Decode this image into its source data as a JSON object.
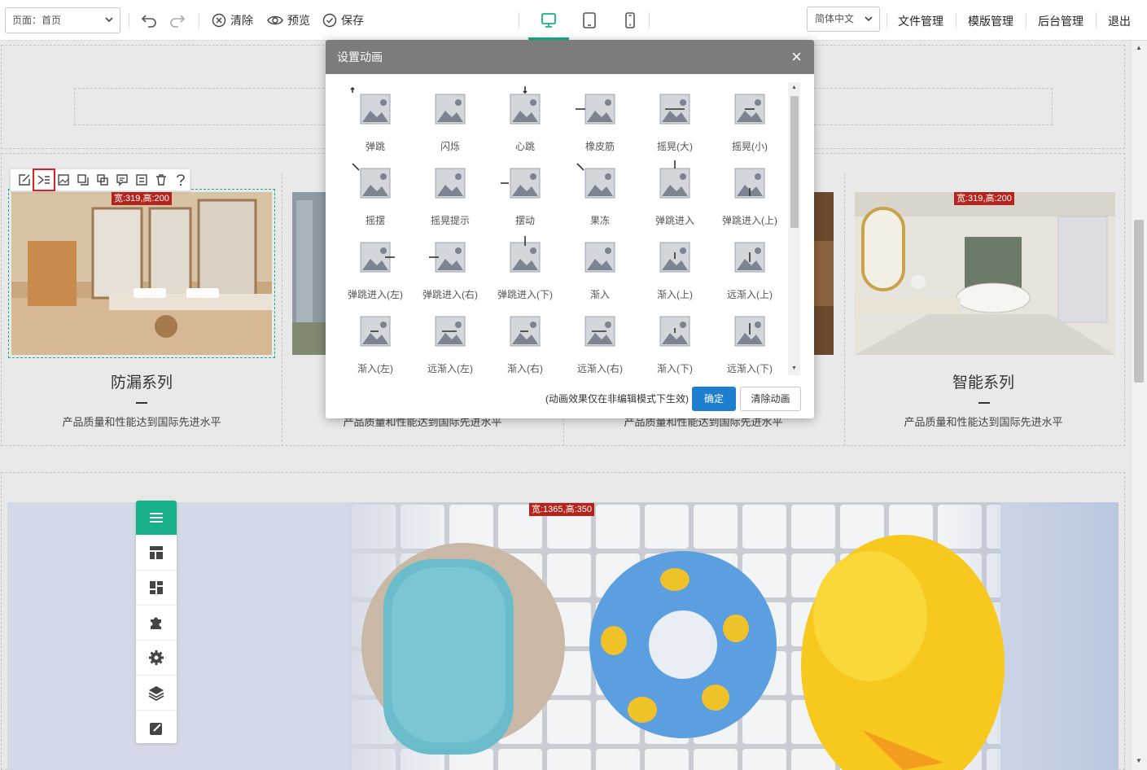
{
  "toolbar": {
    "page_select": "页面：首页",
    "clear_label": "清除",
    "preview_label": "预览",
    "save_label": "保存",
    "language_select": "简体中文",
    "links": [
      "文件管理",
      "模版管理",
      "后台管理",
      "退出"
    ]
  },
  "colors": {
    "accent": "#17b08a",
    "primary_button": "#1e7fd0",
    "size_tag": "#b3251c",
    "modal_header": "#7c7c7c"
  },
  "canvas": {
    "products": [
      {
        "title": "防漏系列",
        "desc": "产品质量和性能达到国际先进水平",
        "size_tag": "宽:319,高:200"
      },
      {
        "title": "",
        "desc": "产品质量和性能达到国际先进水平",
        "size_tag": ""
      },
      {
        "title": "",
        "desc": "产品质量和性能达到国际先进水平",
        "size_tag": ""
      },
      {
        "title": "智能系列",
        "desc": "产品质量和性能达到国际先进水平",
        "size_tag": "宽:319,高:200"
      }
    ],
    "banner_size_tag": "宽:1365,高:350",
    "element_tools": [
      "edit-icon",
      "animation-icon",
      "image-icon",
      "copy-icon",
      "duplicate-icon",
      "comment-icon",
      "list-icon",
      "delete-icon",
      "help-icon"
    ],
    "side_menu": [
      "menu-icon",
      "layout-icon",
      "widgets-icon",
      "plugin-icon",
      "settings-icon",
      "layers-icon",
      "edit-icon"
    ]
  },
  "modal": {
    "title": "设置动画",
    "animations": [
      "弹跳",
      "闪烁",
      "心跳",
      "橡皮筋",
      "摇晃(大)",
      "摇晃(小)",
      "摇摆",
      "摇晃提示",
      "摆动",
      "果冻",
      "弹跳进入",
      "弹跳进入(上)",
      "弹跳进入(左)",
      "弹跳进入(右)",
      "弹跳进入(下)",
      "渐入",
      "渐入(上)",
      "远渐入(上)",
      "渐入(左)",
      "远渐入(左)",
      "渐入(右)",
      "远渐入(右)",
      "渐入(下)",
      "远渐入(下)"
    ],
    "note": "(动画效果仅在非编辑模式下生效)",
    "ok_label": "确定",
    "clear_label": "清除动画"
  }
}
